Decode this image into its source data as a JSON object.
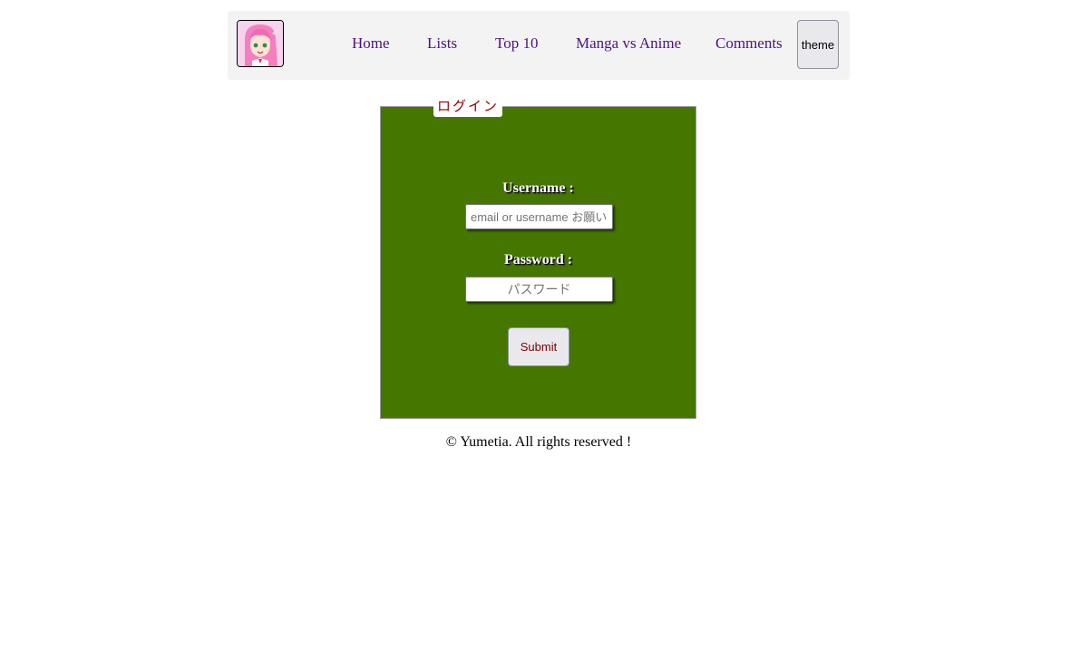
{
  "nav": {
    "logo_alt": "anime girl avatar",
    "links": [
      "Home",
      "Lists",
      "Top 10",
      "Manga vs Anime",
      "Comments"
    ],
    "theme_label": "theme"
  },
  "login": {
    "legend": "ログイン",
    "username_label": "Username :",
    "username_placeholder": "email or username お願い",
    "password_label": "Password :",
    "password_placeholder": "パスワード",
    "submit_label": "Submit"
  },
  "footer": {
    "text": "© Yumetia. All rights reserved !"
  },
  "colors": {
    "navbar_bg": "#f3f3f3",
    "link": "#4b137f",
    "form_bg": "#447600",
    "legend_text": "#8b0000",
    "submit_text": "#7a0000"
  }
}
